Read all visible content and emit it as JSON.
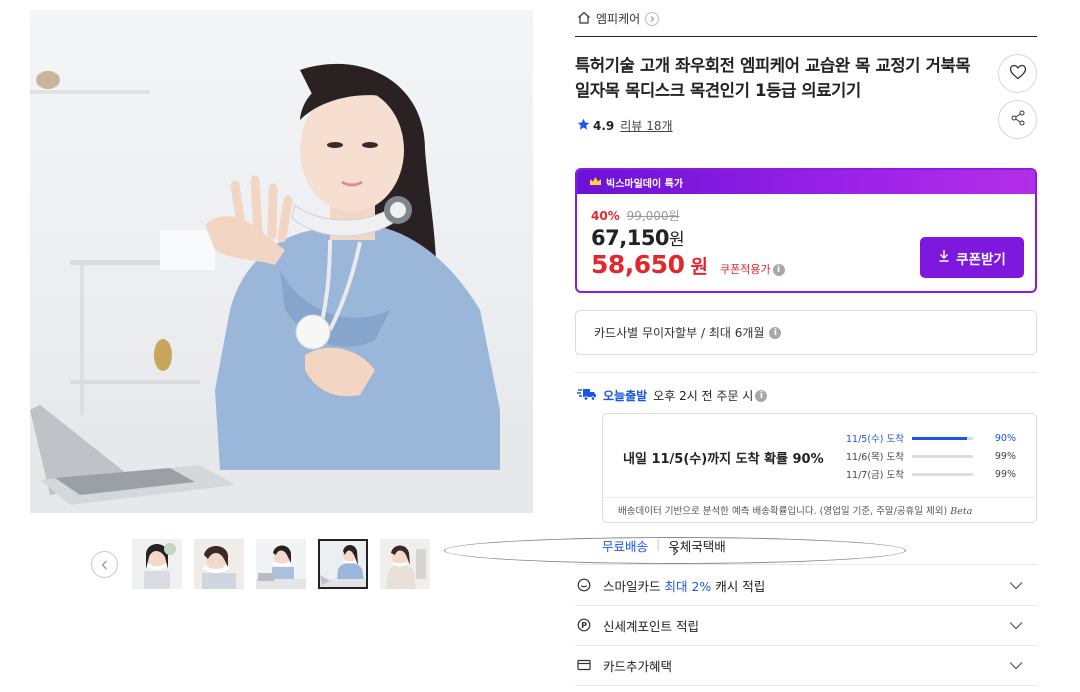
{
  "gallery": {
    "thumbnails": [
      {
        "label": "product photo 1"
      },
      {
        "label": "product photo 2"
      },
      {
        "label": "product photo 3"
      },
      {
        "label": "product photo 4",
        "active": true
      },
      {
        "label": "product photo 5"
      }
    ],
    "prev_icon": "chevron-left-icon",
    "next_icon": "chevron-right-icon"
  },
  "brand": {
    "icon": "home-icon",
    "name": "엠피케어"
  },
  "product": {
    "title": "특허기술 고개 좌우회전 엠피케어 교습완 목 교정기 거북목 일자목 목디스크 목견인기 1등급 의료기기",
    "rating": "4.9",
    "reviews_label": "리뷰",
    "reviews_count": "18개"
  },
  "deal": {
    "banner": "빅스마일데이 특가",
    "discount_pct": "40%",
    "original_price": "99,000원",
    "price": "67,150",
    "price_unit": "원",
    "coupon_price": "58,650",
    "coupon_unit": "원",
    "coupon_price_label": "쿠폰적용가",
    "coupon_button": "쿠폰받기",
    "accent_color": "#7d18dc",
    "sale_color": "#e0282d"
  },
  "installment": {
    "text": "카드사별 무이자할부 / 최대 6개월"
  },
  "shipping": {
    "badge": "오늘출발",
    "cutoff": "오후 2시 전 주문 시",
    "headline": "내일 11/5(수)까지 도착 확률 90%",
    "estimates": [
      {
        "date": "11/5(수) 도착",
        "probability": 0.9,
        "percent_label": "90%"
      },
      {
        "date": "11/6(목) 도착",
        "probability": 0.99,
        "percent_label": "99%"
      },
      {
        "date": "11/7(금) 도착",
        "probability": 0.99,
        "percent_label": "99%"
      }
    ],
    "note": "배송데이터 기반으로 분석한 예측 배송확률입니다. (영업일 기준, 주말/공휴일 제외)",
    "beta": "Beta",
    "free_label": "무료배송",
    "carrier": "우체국택배",
    "highlight_color": "#1a57e8"
  },
  "benefits": [
    {
      "icon": "smile-card-icon",
      "prefix": "스마일카드 ",
      "highlight": "최대 2%",
      "suffix": " 캐시 적립"
    },
    {
      "icon": "point-icon",
      "prefix": "신세계포인트 적립",
      "highlight": "",
      "suffix": ""
    },
    {
      "icon": "card-icon",
      "prefix": "카드추가혜택",
      "highlight": "",
      "suffix": ""
    }
  ]
}
